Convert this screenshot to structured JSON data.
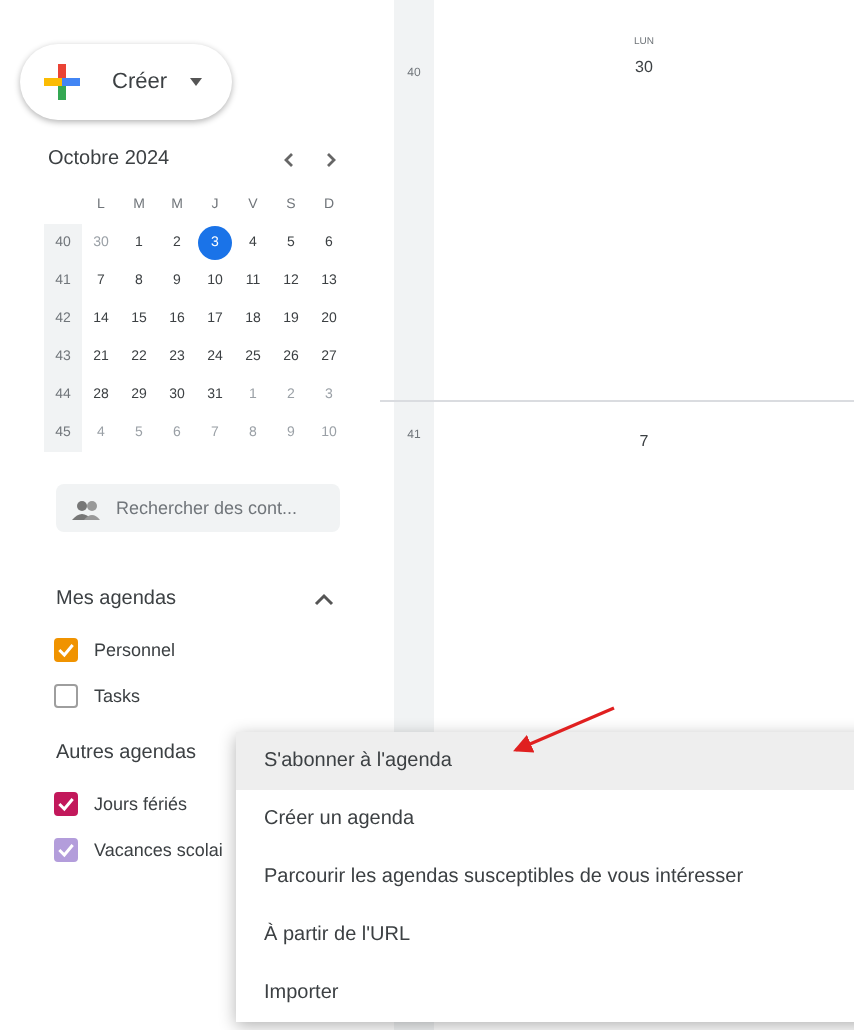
{
  "create_button": {
    "label": "Créer"
  },
  "mini_calendar": {
    "month": "Octobre 2024",
    "weekdays": [
      "L",
      "M",
      "M",
      "J",
      "V",
      "S",
      "D"
    ],
    "weeks": [
      {
        "number": "40",
        "days": [
          {
            "day": "30",
            "in_month": false,
            "selected": false
          },
          {
            "day": "1",
            "in_month": true,
            "selected": false
          },
          {
            "day": "2",
            "in_month": true,
            "selected": false
          },
          {
            "day": "3",
            "in_month": true,
            "selected": true
          },
          {
            "day": "4",
            "in_month": true,
            "selected": false
          },
          {
            "day": "5",
            "in_month": true,
            "selected": false
          },
          {
            "day": "6",
            "in_month": true,
            "selected": false
          }
        ]
      },
      {
        "number": "41",
        "days": [
          {
            "day": "7",
            "in_month": true,
            "selected": false
          },
          {
            "day": "8",
            "in_month": true,
            "selected": false
          },
          {
            "day": "9",
            "in_month": true,
            "selected": false
          },
          {
            "day": "10",
            "in_month": true,
            "selected": false
          },
          {
            "day": "11",
            "in_month": true,
            "selected": false
          },
          {
            "day": "12",
            "in_month": true,
            "selected": false
          },
          {
            "day": "13",
            "in_month": true,
            "selected": false
          }
        ]
      },
      {
        "number": "42",
        "days": [
          {
            "day": "14",
            "in_month": true,
            "selected": false
          },
          {
            "day": "15",
            "in_month": true,
            "selected": false
          },
          {
            "day": "16",
            "in_month": true,
            "selected": false
          },
          {
            "day": "17",
            "in_month": true,
            "selected": false
          },
          {
            "day": "18",
            "in_month": true,
            "selected": false
          },
          {
            "day": "19",
            "in_month": true,
            "selected": false
          },
          {
            "day": "20",
            "in_month": true,
            "selected": false
          }
        ]
      },
      {
        "number": "43",
        "days": [
          {
            "day": "21",
            "in_month": true,
            "selected": false
          },
          {
            "day": "22",
            "in_month": true,
            "selected": false
          },
          {
            "day": "23",
            "in_month": true,
            "selected": false
          },
          {
            "day": "24",
            "in_month": true,
            "selected": false
          },
          {
            "day": "25",
            "in_month": true,
            "selected": false
          },
          {
            "day": "26",
            "in_month": true,
            "selected": false
          },
          {
            "day": "27",
            "in_month": true,
            "selected": false
          }
        ]
      },
      {
        "number": "44",
        "days": [
          {
            "day": "28",
            "in_month": true,
            "selected": false
          },
          {
            "day": "29",
            "in_month": true,
            "selected": false
          },
          {
            "day": "30",
            "in_month": true,
            "selected": false
          },
          {
            "day": "31",
            "in_month": true,
            "selected": false
          },
          {
            "day": "1",
            "in_month": false,
            "selected": false
          },
          {
            "day": "2",
            "in_month": false,
            "selected": false
          },
          {
            "day": "3",
            "in_month": false,
            "selected": false
          }
        ]
      },
      {
        "number": "45",
        "days": [
          {
            "day": "4",
            "in_month": false,
            "selected": false
          },
          {
            "day": "5",
            "in_month": false,
            "selected": false
          },
          {
            "day": "6",
            "in_month": false,
            "selected": false
          },
          {
            "day": "7",
            "in_month": false,
            "selected": false
          },
          {
            "day": "8",
            "in_month": false,
            "selected": false
          },
          {
            "day": "9",
            "in_month": false,
            "selected": false
          },
          {
            "day": "10",
            "in_month": false,
            "selected": false
          }
        ]
      }
    ]
  },
  "contact_search": {
    "placeholder": "Rechercher des cont..."
  },
  "my_calendars": {
    "title": "Mes agendas",
    "expanded": true,
    "items": [
      {
        "label": "Personnel",
        "checked": true,
        "color": "#f09300"
      },
      {
        "label": "Tasks",
        "checked": false,
        "color": "#9e9e9e"
      }
    ]
  },
  "other_calendars": {
    "title": "Autres agendas",
    "items": [
      {
        "label": "Jours fériés",
        "checked": true,
        "color": "#c2185b"
      },
      {
        "label": "Vacances scolai",
        "checked": true,
        "color": "#b39ddb"
      }
    ]
  },
  "month_view": {
    "weekday": "LUN",
    "rows": [
      {
        "week": "40",
        "date": "30"
      },
      {
        "week": "41",
        "date": "7"
      }
    ]
  },
  "menu": {
    "items": [
      {
        "label": "S'abonner à l'agenda",
        "selected": true
      },
      {
        "label": "Créer un agenda",
        "selected": false
      },
      {
        "label": "Parcourir les agendas susceptibles de vous intéresser",
        "selected": false
      },
      {
        "label": "À partir de l'URL",
        "selected": false
      },
      {
        "label": "Importer",
        "selected": false
      }
    ]
  }
}
